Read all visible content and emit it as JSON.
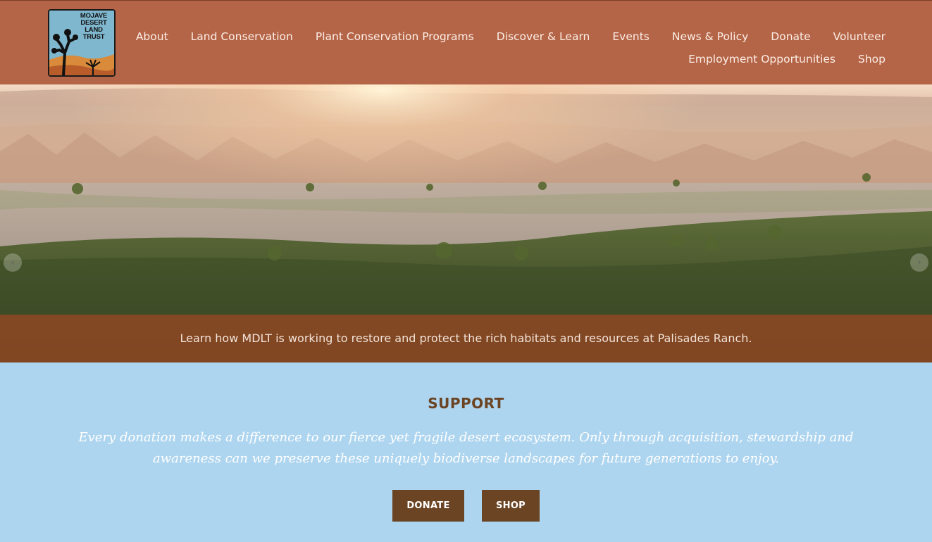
{
  "logo": {
    "lines": [
      "MOJAVE",
      "DESERT",
      "LAND",
      "TRUST"
    ]
  },
  "nav": {
    "row1": [
      "About",
      "Land Conservation",
      "Plant Conservation Programs",
      "Discover & Learn",
      "Events",
      "News & Policy",
      "Donate",
      "Volunteer"
    ],
    "row2": [
      "Employment Opportunities",
      "Shop"
    ]
  },
  "hero": {
    "caption": "Learn how MDLT is working to restore and protect the rich habitats and resources at Palisades Ranch.",
    "prev_icon": "chevron-left-icon",
    "next_icon": "chevron-right-icon"
  },
  "support": {
    "title": "SUPPORT",
    "text": "Every donation makes a difference to our fierce yet fragile desert ecosystem. Only through acquisition, stewardship and awareness can we preserve these uniquely biodiverse landscapes for future generations to enjoy.",
    "donate_label": "DONATE",
    "shop_label": "SHOP"
  },
  "colors": {
    "header": "#b56547",
    "caption_bar": "#96462399",
    "support_bg": "#aed5ef",
    "button": "#6b4424"
  }
}
